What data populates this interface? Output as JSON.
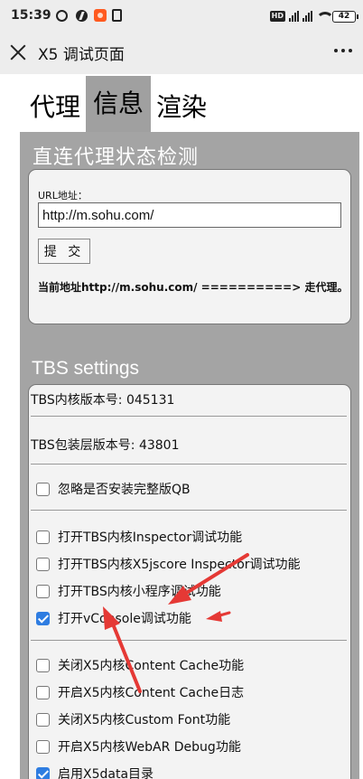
{
  "status_bar": {
    "time": "15:39",
    "hd_badge": "HD",
    "battery": "42"
  },
  "title_bar": {
    "title": "X5 调试页面"
  },
  "tabs": [
    {
      "label": "代理",
      "active": false
    },
    {
      "label": "信息",
      "active": true
    },
    {
      "label": "渲染",
      "active": false
    }
  ],
  "proxy_section": {
    "heading": "直连代理状态检测",
    "url_label": "URL地址：",
    "url_value": "http://m.sohu.com/",
    "submit_label": "提 交",
    "result": "当前地址http://m.sohu.com/ ==========> 走代理。"
  },
  "tbs": {
    "heading": "TBS settings",
    "core_version": "TBS内核版本号: 045131",
    "shell_version": "TBS包装层版本号: 43801",
    "options": [
      {
        "label": "忽略是否安装完整版QB",
        "checked": false
      },
      {
        "label": "打开TBS内核Inspector调试功能",
        "checked": false
      },
      {
        "label": "打开TBS内核X5jscore Inspector调试功能",
        "checked": false
      },
      {
        "label": "打开TBS内核小程序调试功能",
        "checked": false
      },
      {
        "label": "打开vConsole调试功能",
        "checked": true
      },
      {
        "label": "关闭X5内核Content Cache功能",
        "checked": false
      },
      {
        "label": "开启X5内核Content Cache日志",
        "checked": false
      },
      {
        "label": "关闭X5内核Custom Font功能",
        "checked": false
      },
      {
        "label": "开启X5内核WebAR Debug功能",
        "checked": false
      },
      {
        "label": "启用X5data目录",
        "checked": true
      }
    ]
  },
  "annotation_color": "#e53935"
}
